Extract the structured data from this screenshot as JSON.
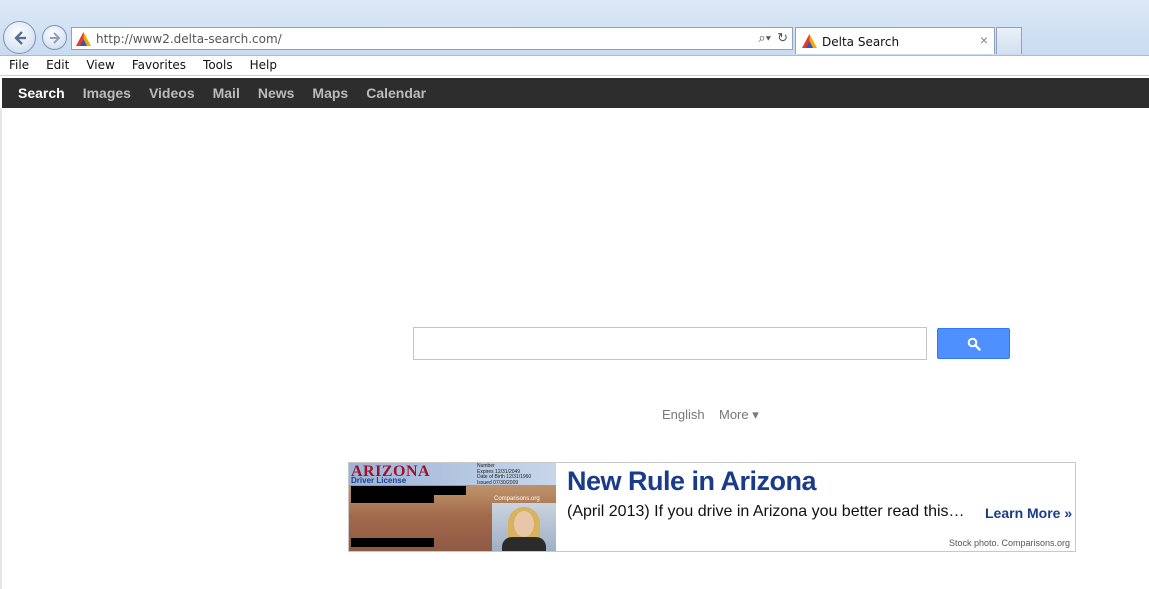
{
  "browser": {
    "address": "http://www2.delta-search.com/",
    "tab_title": "Delta Search",
    "tab_close": "×"
  },
  "menu": [
    "File",
    "Edit",
    "View",
    "Favorites",
    "Tools",
    "Help"
  ],
  "navbar": {
    "items": [
      "Search",
      "Images",
      "Videos",
      "Mail",
      "News",
      "Maps",
      "Calendar"
    ],
    "active": "Search"
  },
  "search": {
    "value": "",
    "button_icon": "magnifier-icon"
  },
  "language": {
    "current": "English",
    "more": "More ▾"
  },
  "ad": {
    "title": "New Rule in Arizona",
    "text": "(April 2013) If you drive in Arizona you better read this…",
    "cta": "Learn More »",
    "credit": "Stock photo. Comparisons.org",
    "image": {
      "state": "ARIZONA",
      "subtitle": "Driver License",
      "fields": [
        "Number",
        "Expires  12/31/2049",
        "Date of Birth  12/31/1960",
        "Issued  07/30/2009"
      ],
      "watermark": "Comparisons.org"
    }
  },
  "colors": {
    "navbar_bg": "#2d2d2d",
    "search_button": "#4d90fe",
    "ad_title": "#1a3a8a"
  }
}
